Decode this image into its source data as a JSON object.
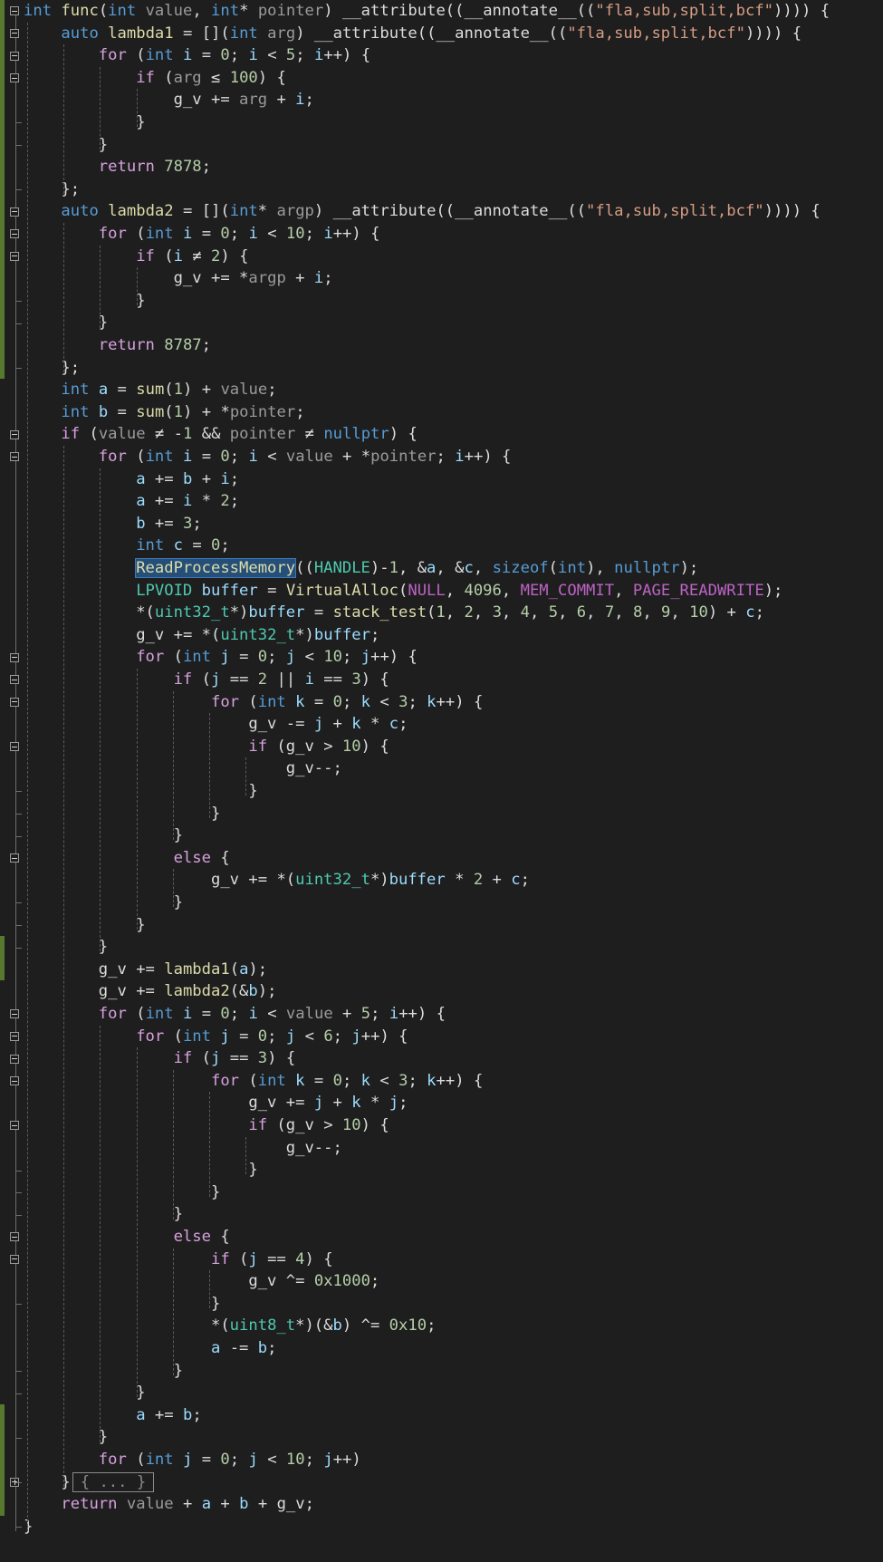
{
  "editor": {
    "language": "C++",
    "lines": [
      "int func(int value, int* pointer) __attribute((__annotate__((\"fla,sub,split,bcf\")))) {",
      "    auto lambda1 = [](int arg) __attribute((__annotate__((\"fla,sub,split,bcf\")))) {",
      "        for (int i = 0; i < 5; i++) {",
      "            if (arg ≤ 100) {",
      "                g_v += arg + i;",
      "            }",
      "        }",
      "        return 7878;",
      "    };",
      "    auto lambda2 = [](int* argp) __attribute((__annotate__((\"fla,sub,split,bcf\")))) {",
      "        for (int i = 0; i < 10; i++) {",
      "            if (i ≠ 2) {",
      "                g_v += *argp + i;",
      "            }",
      "        }",
      "        return 8787;",
      "    };",
      "    int a = sum(1) + value;",
      "    int b = sum(1) + *pointer;",
      "    if (value ≠ -1 && pointer ≠ nullptr) {",
      "        for (int i = 0; i < value + *pointer; i++) {",
      "            a += b + i;",
      "            a += i * 2;",
      "            b += 3;",
      "            int c = 0;",
      "            ReadProcessMemory((HANDLE)-1, &a, &c, sizeof(int), nullptr);",
      "            LPVOID buffer = VirtualAlloc(NULL, 4096, MEM_COMMIT, PAGE_READWRITE);",
      "            *(uint32_t*)buffer = stack_test(1, 2, 3, 4, 5, 6, 7, 8, 9, 10) + c;",
      "            g_v += *(uint32_t*)buffer;",
      "            for (int j = 0; j < 10; j++) {",
      "                if (j == 2 || i == 3) {",
      "                    for (int k = 0; k < 3; k++) {",
      "                        g_v -= j + k * c;",
      "                        if (g_v > 10) {",
      "                            g_v--;",
      "                        }",
      "                    }",
      "                }",
      "                else {",
      "                    g_v += *(uint32_t*)buffer * 2 + c;",
      "                }",
      "            }",
      "        }",
      "        g_v += lambda1(a);",
      "        g_v += lambda2(&b);",
      "        for (int i = 0; i < value + 5; i++) {",
      "            for (int j = 0; j < 6; j++) {",
      "                if (j == 3) {",
      "                    for (int k = 0; k < 3; k++) {",
      "                        g_v += j + k * j;",
      "                        if (g_v > 10) {",
      "                            g_v--;",
      "                        }",
      "                    }",
      "                }",
      "                else {",
      "                    if (j == 4) {",
      "                        g_v ^= 0x1000;",
      "                    }",
      "                    *(uint8_t*)(&b) ^= 0x10;",
      "                    a -= b;",
      "                }",
      "            }",
      "            a += b;",
      "        }",
      "        for (int j = 0; j < 10; j++)",
      "    }",
      "    return value + a + b + g_v;",
      "}"
    ],
    "highlighted_identifier": "ReadProcessMemory",
    "collapsed_placeholder": "{ ... }",
    "colors": {
      "background": "#1e1e1e",
      "keyword": "#569cd6",
      "control": "#d8a0df",
      "function": "#dcdcaa",
      "type": "#4ec9b0",
      "number": "#b5cea8",
      "string": "#d69d85",
      "macro": "#bd63c5",
      "change_bar": "#57792f",
      "selection": "#264f78"
    }
  }
}
